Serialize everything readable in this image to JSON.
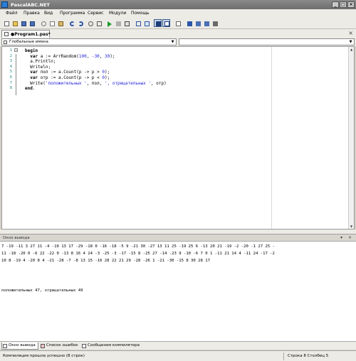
{
  "window": {
    "title": "PascalABC.NET",
    "minimize": "_",
    "maximize": "□",
    "close": "×"
  },
  "menu": [
    "Файл",
    "Правка",
    "Вид",
    "Программа",
    "Сервис",
    "Модули",
    "Помощь"
  ],
  "toolbar": {
    "icons": [
      "new-file-icon",
      "open-icon",
      "save-icon",
      "save-all-icon",
      "cut-icon",
      "copy-icon",
      "paste-icon",
      "undo-icon",
      "redo-icon",
      "find-icon",
      "replace-icon",
      "run-icon",
      "stop-icon",
      "debug-icon",
      "step-over-icon",
      "step-into-icon",
      "output-window-icon",
      "split-window-icon",
      "format-icon",
      "compile-icon",
      "settings-icon",
      "help-icon",
      "about-icon"
    ]
  },
  "document_tab": {
    "label": "●Program1.pas*",
    "close": "×"
  },
  "scope_combo": {
    "value": "Глобальные имена"
  },
  "editor": {
    "lines": [
      {
        "n": "1",
        "html": "<span class=\"kw\">begin</span>"
      },
      {
        "n": "2",
        "html": "  <span class=\"kw\">var</span> a := ArrRandom(<span class=\"num\">100</span>, <span class=\"num\">-30</span>, <span class=\"num\">30</span>);"
      },
      {
        "n": "3",
        "html": "  a.Println;"
      },
      {
        "n": "4",
        "html": "  Writeln;"
      },
      {
        "n": "5",
        "html": "  <span class=\"kw\">var</span> пол := a.Count(p -> p > <span class=\"num\">0</span>);"
      },
      {
        "n": "6",
        "html": "  <span class=\"kw\">var</span> отр := a.Count(p -> p < <span class=\"num\">0</span>);"
      },
      {
        "n": "7",
        "html": "  Write(<span class=\"str\">'положительных '</span>, пол, <span class=\"str\">', отрицательных '</span>, отр)"
      },
      {
        "n": "8",
        "html": "<span class=\"kw\">end</span>."
      }
    ]
  },
  "output": {
    "title": "Окно вывода",
    "lines": [
      "7 -19 -11 3 27 11 -4 -10 13 17 -29 -18 0 -16 -18 -5 9 -21 30 -27 13 11 25 -19 25 6 -13 20 21 -19 -2 -20 -1 27 25 -",
      "11 -18 -20 0 -6 22 -22 0 -13 8 16 4 24 -3 -25 -3 -17 -15 8 -25 27 -14 -23 9 -10 -6 7 0 1 -11 21 14 4 -11 24 -17 -2",
      "10 8 -19 4 -20 8 4 -21 -28 -7 -8 13 15 -16 28 22 21 29 -28 -26 1 -21 -30 -15 8 30 28 17",
      "",
      "положительных 47, отрицательных 49"
    ]
  },
  "bottom_tabs": [
    "Окно вывода",
    "Список ошибок",
    "Сообщения компилятора"
  ],
  "status": {
    "message": "Компиляция прошла успешно (8 строк)",
    "position": "Строка  8  Столбец  5"
  }
}
